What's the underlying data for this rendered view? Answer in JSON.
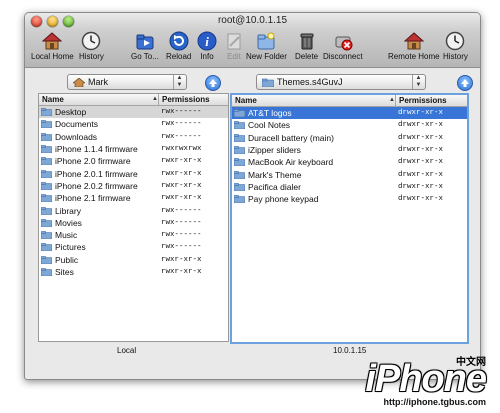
{
  "window": {
    "title": "root@10.0.1.15"
  },
  "toolbar": {
    "local_home": "Local Home",
    "history": "History",
    "go_to": "Go To...",
    "reload": "Reload",
    "info": "Info",
    "edit": "Edit",
    "new_folder": "New Folder",
    "delete": "Delete",
    "disconnect": "Disconnect",
    "remote_home": "Remote Home",
    "remote_history": "History"
  },
  "local": {
    "path": "Mark",
    "col_name": "Name",
    "col_perm": "Permissions",
    "label": "Local",
    "files": [
      {
        "name": "Desktop",
        "perm": "rwx------"
      },
      {
        "name": "Documents",
        "perm": "rwx------"
      },
      {
        "name": "Downloads",
        "perm": "rwx------"
      },
      {
        "name": "iPhone 1.1.4 firmware",
        "perm": "rwxrwxrwx"
      },
      {
        "name": "iPhone 2.0 firmware",
        "perm": "rwxr-xr-x"
      },
      {
        "name": "iPhone 2.0.1 firmware",
        "perm": "rwxr-xr-x"
      },
      {
        "name": "iPhone 2.0.2 firmware",
        "perm": "rwxr-xr-x"
      },
      {
        "name": "iPhone 2.1 firmware",
        "perm": "rwxr-xr-x"
      },
      {
        "name": "Library",
        "perm": "rwx------"
      },
      {
        "name": "Movies",
        "perm": "rwx------"
      },
      {
        "name": "Music",
        "perm": "rwx------"
      },
      {
        "name": "Pictures",
        "perm": "rwx------"
      },
      {
        "name": "Public",
        "perm": "rwxr-xr-x"
      },
      {
        "name": "Sites",
        "perm": "rwxr-xr-x"
      }
    ]
  },
  "remote": {
    "path": "Themes.s4GuvJ",
    "col_name": "Name",
    "col_perm": "Permissions",
    "label": "10.0.1.15",
    "files": [
      {
        "name": "AT&T logos",
        "perm": "drwxr-xr-x"
      },
      {
        "name": "Cool Notes",
        "perm": "drwxr-xr-x"
      },
      {
        "name": "Duracell battery (main)",
        "perm": "drwxr-xr-x"
      },
      {
        "name": "iZipper sliders",
        "perm": "drwxr-xr-x"
      },
      {
        "name": "MacBook Air keyboard",
        "perm": "drwxr-xr-x"
      },
      {
        "name": "Mark's Theme",
        "perm": "drwxr-xr-x"
      },
      {
        "name": "Pacifica dialer",
        "perm": "drwxr-xr-x"
      },
      {
        "name": "Pay phone keypad",
        "perm": "drwxr-xr-x"
      }
    ]
  },
  "watermark": {
    "brand": "iPhone",
    "cn": "中文网",
    "url": "http://iphone.tgbus.com"
  },
  "colors": {
    "selection": "#3875d7",
    "focus_ring": "#6da1dd",
    "folder": "#7fa7d6"
  }
}
